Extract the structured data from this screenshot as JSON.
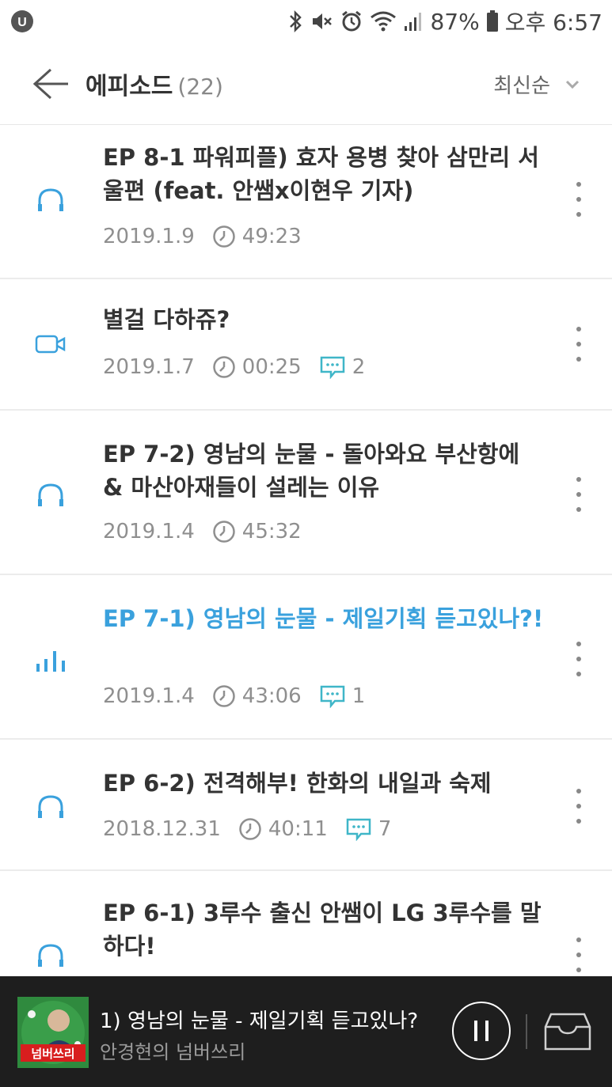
{
  "status_bar": {
    "battery": "87%",
    "time": "오후 6:57"
  },
  "header": {
    "title": "에피소드",
    "count": "(22)",
    "sort_label": "최신순"
  },
  "episodes": [
    {
      "title": "EP 8-1 파워피플) 효자 용병 찾아 삼만리 서울편 (feat. 안쌤x이현우 기자)",
      "date": "2019.1.9",
      "duration": "49:23",
      "comments": "",
      "type": "audio",
      "playing": false
    },
    {
      "title": "별걸 다하쥬?",
      "date": "2019.1.7",
      "duration": "00:25",
      "comments": "2",
      "type": "video",
      "playing": false
    },
    {
      "title": "EP 7-2) 영남의 눈물 - 돌아와요 부산항에 & 마산아재들이 설레는 이유",
      "date": "2019.1.4",
      "duration": "45:32",
      "comments": "",
      "type": "audio",
      "playing": false
    },
    {
      "title": "EP 7-1) 영남의 눈물 - 제일기획 듣고있나?!",
      "date": "2019.1.4",
      "duration": "43:06",
      "comments": "1",
      "type": "audio",
      "playing": true
    },
    {
      "title": "EP 6-2) 전격해부! 한화의 내일과 숙제",
      "date": "2018.12.31",
      "duration": "40:11",
      "comments": "7",
      "type": "audio",
      "playing": false
    },
    {
      "title": "EP 6-1) 3루수 출신 안쌤이 LG 3루수를 말하다!",
      "date": "",
      "duration": "",
      "comments": "",
      "type": "audio",
      "playing": false
    }
  ],
  "player": {
    "title": "1) 영남의 눈물 - 제일기획 듣고있나?",
    "channel": "안경현의 넘버쓰리",
    "thumb_text": "넘버쓰리"
  },
  "colors": {
    "accent": "#3aa1dd",
    "comment_icon": "#3fb6c8",
    "player_bg": "#1e1e1e"
  }
}
